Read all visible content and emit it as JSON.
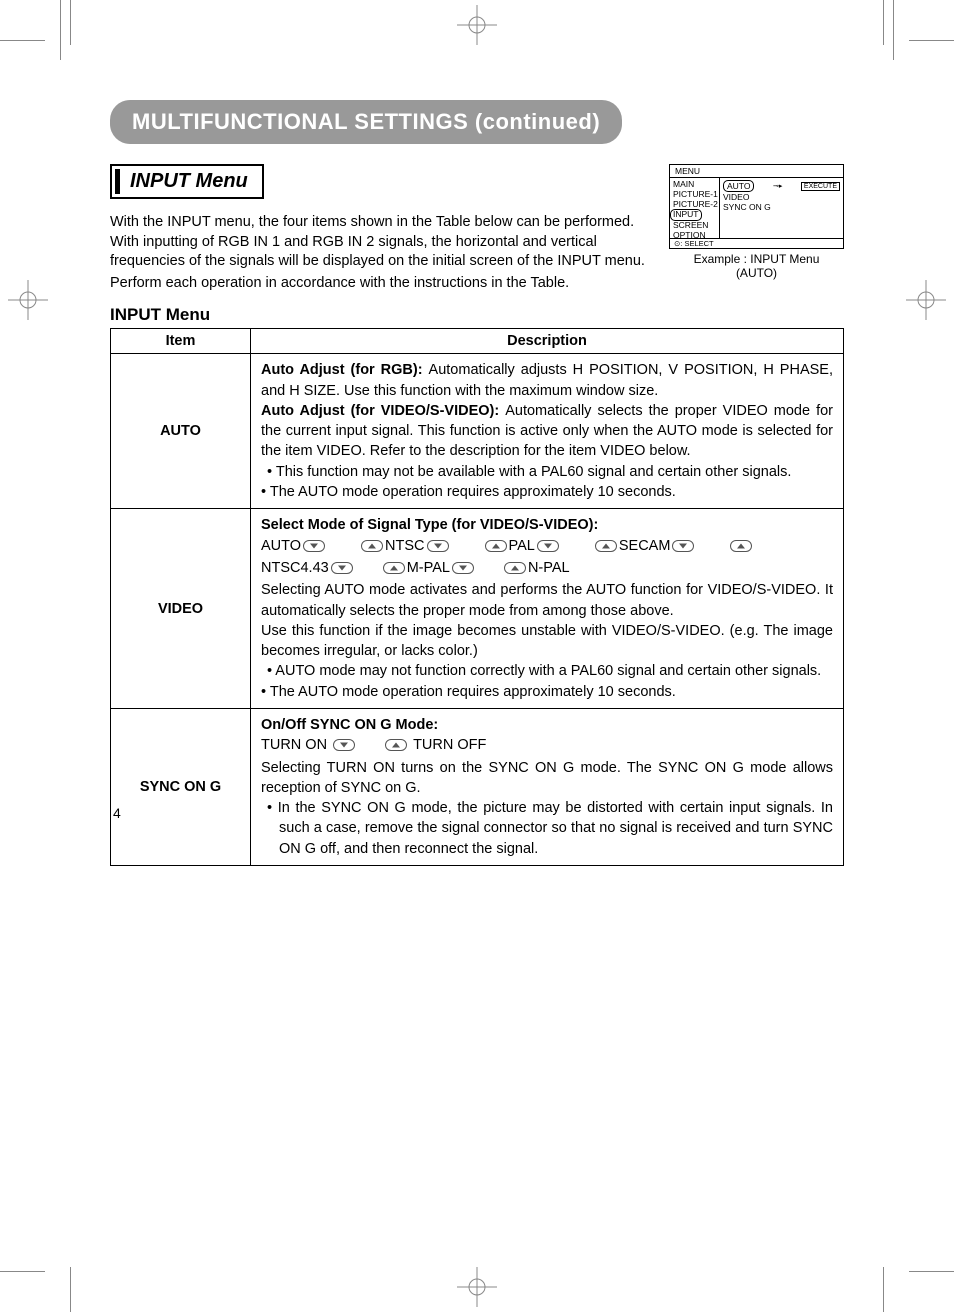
{
  "heading": "MULTIFUNCTIONAL SETTINGS (continued)",
  "section_title": "INPUT Menu",
  "intro": {
    "p1": "With the INPUT menu, the four items shown in the Table below can be performed. With inputting of RGB IN 1 and RGB IN 2 signals, the horizontal and vertical frequencies of the signals will be displayed on the initial screen of the INPUT menu.",
    "p2": "Perform each operation in accordance with the instructions in the Table."
  },
  "osd": {
    "menu_label": "MENU",
    "left_items": [
      "MAIN",
      "PICTURE-1",
      "PICTURE-2",
      "INPUT",
      "SCREEN",
      "OPTION"
    ],
    "selected_left": "INPUT",
    "right_items": [
      "AUTO",
      "VIDEO",
      "SYNC ON G"
    ],
    "execute": "EXECUTE",
    "footer": ": SELECT",
    "caption_l1": "Example : INPUT Menu",
    "caption_l2": "(AUTO)"
  },
  "table_title": "INPUT Menu",
  "table": {
    "header_item": "Item",
    "header_desc": "Description",
    "rows": [
      {
        "item": "AUTO",
        "b1": "Auto Adjust (for RGB): ",
        "t1": "Automatically adjusts H POSITION, V POSITION, H PHASE, and H SIZE. Use this function with the maximum window size.",
        "b2": "Auto Adjust (for VIDEO/S-VIDEO): ",
        "t2": "Automatically selects the proper VIDEO mode for the current input signal. This function is active only when the AUTO mode is selected for the item VIDEO. Refer to the description for the item VIDEO below.",
        "bul1": "• This function may not be available with a PAL60 signal and certain other signals.",
        "bul2": "• The AUTO mode operation requires approximately 10 seconds."
      },
      {
        "item": "VIDEO",
        "b1": "Select Mode of Signal Type (for VIDEO/S-VIDEO):",
        "modes": [
          "AUTO",
          "NTSC",
          "PAL",
          "SECAM",
          "NTSC4.43",
          "M-PAL",
          "N-PAL"
        ],
        "t1": "Selecting AUTO mode activates and performs the AUTO function for VIDEO/S-VIDEO. It automatically selects the proper mode from among those above.",
        "t2": "Use this function if the image becomes unstable with VIDEO/S-VIDEO. (e.g. The image becomes irregular, or lacks color.)",
        "bul1": "• AUTO mode may not function correctly with a PAL60 signal and certain other signals.",
        "bul2": "• The AUTO mode operation requires approximately 10 seconds."
      },
      {
        "item": "SYNC ON G",
        "b1": "On/Off SYNC ON G Mode:",
        "on_label": "TURN ON",
        "off_label": "TURN OFF",
        "t1": "Selecting TURN ON turns on the SYNC ON G mode. The SYNC ON G mode allows reception of SYNC on G.",
        "bul1": "• In the SYNC ON G mode, the picture may be distorted with certain input signals. In such a case, remove the signal connector so that no signal is received and turn SYNC ON G off, and then reconnect the signal."
      }
    ]
  },
  "page_number": "4"
}
